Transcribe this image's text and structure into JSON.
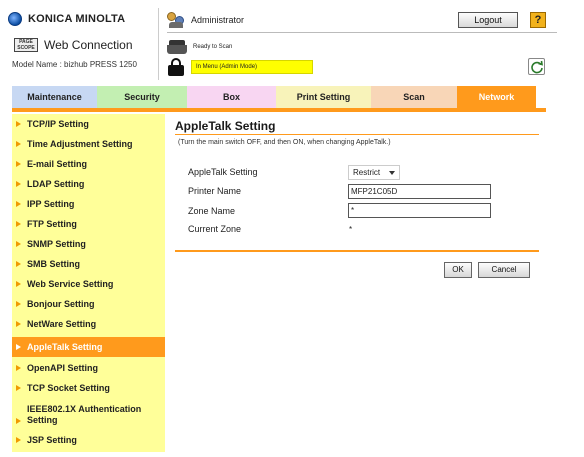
{
  "header": {
    "brand": "KONICA MINOLTA",
    "pagescope_logo": "PAGE SCOPE",
    "app_name": "Web Connection",
    "model": "Model Name : bizhub PRESS 1250",
    "user": "Administrator",
    "status_ready": "Ready to Scan",
    "status_mode": "In Menu (Admin Mode)",
    "logout_label": "Logout",
    "help_label": "?",
    "icons": {
      "brand": "konica-minolta-globe-icon",
      "user": "administrator-users-icon",
      "status": "printer-icon",
      "mode": "lock-icon",
      "refresh": "refresh-icon"
    }
  },
  "tabs": [
    {
      "label": "Maintenance",
      "active": false
    },
    {
      "label": "Security",
      "active": false
    },
    {
      "label": "Box",
      "active": false
    },
    {
      "label": "Print Setting",
      "active": false
    },
    {
      "label": "Scan",
      "active": false
    },
    {
      "label": "Network",
      "active": true
    }
  ],
  "sidebar": {
    "items": [
      {
        "label": "TCP/IP Setting"
      },
      {
        "label": "Time Adjustment Setting"
      },
      {
        "label": "E-mail Setting"
      },
      {
        "label": "LDAP Setting"
      },
      {
        "label": "IPP Setting"
      },
      {
        "label": "FTP Setting"
      },
      {
        "label": "SNMP Setting"
      },
      {
        "label": "SMB Setting"
      },
      {
        "label": "Web Service Setting"
      },
      {
        "label": "Bonjour Setting"
      },
      {
        "label": "NetWare Setting"
      },
      {
        "label": "AppleTalk Setting",
        "active": true
      },
      {
        "label": "OpenAPI Setting"
      },
      {
        "label": "TCP Socket Setting"
      },
      {
        "label": "IEEE802.1X Authentication",
        "label2": "Setting"
      },
      {
        "label": "JSP Setting"
      }
    ]
  },
  "main": {
    "title": "AppleTalk Setting",
    "note": "(Turn the main switch OFF, and then ON, when changing AppleTalk.)",
    "form": {
      "appletalk_label": "AppleTalk Setting",
      "appletalk_value": "Restrict",
      "printer_name_label": "Printer Name",
      "printer_name_value": "MFP21C05D",
      "zone_name_label": "Zone Name",
      "zone_name_value": "*",
      "current_zone_label": "Current Zone",
      "current_zone_value": "*"
    },
    "ok_label": "OK",
    "cancel_label": "Cancel"
  },
  "colors": {
    "accent": "#ff9a1c",
    "sidebar_bg": "#ffff99",
    "mode_badge": "#ffff00",
    "tab_maintenance": "#c7d8f3",
    "tab_security": "#c3efb2",
    "tab_box": "#f8d6f2",
    "tab_print_setting": "#f8f3ba",
    "tab_scan": "#f8d6b7"
  }
}
